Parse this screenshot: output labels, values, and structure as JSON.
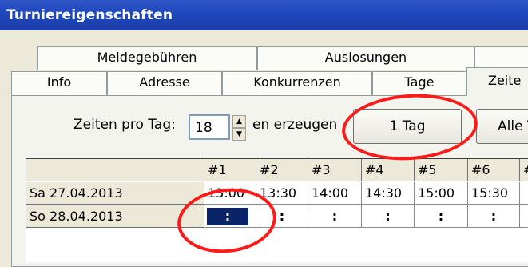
{
  "window": {
    "title": "Turniereigenschaften"
  },
  "tabs": {
    "row1": [
      "Meldegebühren",
      "Auslosungen"
    ],
    "row2": [
      "Info",
      "Adresse",
      "Konkurrenzen",
      "Tage"
    ],
    "active": "Zeite"
  },
  "controls": {
    "times_per_day_label": "Zeiten pro Tag:",
    "times_per_day_value": "18",
    "spin_up": "▲",
    "spin_down": "▼",
    "generate_label": "en erzeugen",
    "one_day_button": "1 Tag",
    "all_button": "Alle T"
  },
  "grid": {
    "columns": [
      "#1",
      "#2",
      "#3",
      "#4",
      "#5",
      "#6",
      "#"
    ],
    "rows": [
      {
        "label": "Sa 27.04.2013",
        "values": [
          "13:00",
          "13:30",
          "14:00",
          "14:30",
          "15:00",
          "15:30",
          ":"
        ]
      },
      {
        "label": "So 28.04.2013",
        "values": [
          ":",
          ":",
          ":",
          ":",
          ":",
          ":",
          ":"
        ]
      }
    ]
  },
  "annotations": {
    "color": "#ff1a1a"
  }
}
